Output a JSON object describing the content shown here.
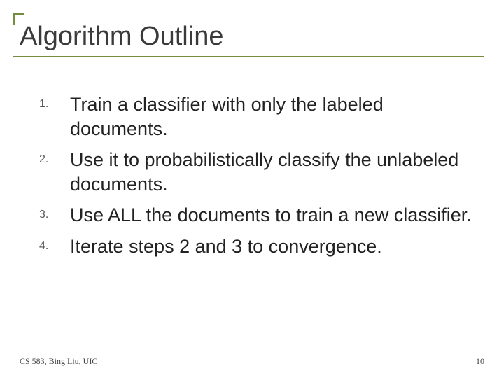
{
  "title": "Algorithm Outline",
  "items": [
    {
      "n": "1.",
      "t": "Train a classifier with only the labeled documents."
    },
    {
      "n": "2.",
      "t": "Use it to probabilistically classify the unlabeled documents."
    },
    {
      "n": "3.",
      "t": "Use ALL the documents to train a new classifier."
    },
    {
      "n": "4.",
      "t": "Iterate steps 2 and 3 to convergence."
    }
  ],
  "footer_left": "CS 583, Bing Liu, UIC",
  "footer_right": "10"
}
